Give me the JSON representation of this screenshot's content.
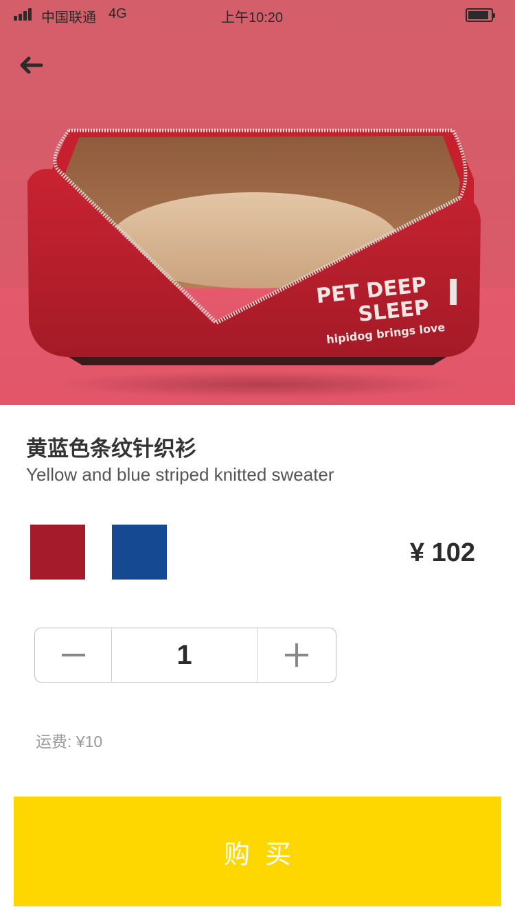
{
  "status_bar": {
    "carrier": "中国联通",
    "network": "4G",
    "time": "上午10:20",
    "battery_level": 0.9
  },
  "header": {
    "back_icon": "arrow-left-icon"
  },
  "product": {
    "image_text_line1": "PET DEEP",
    "image_text_line2": "SLEEP",
    "image_text_line3": "hipidog brings love",
    "title_zh": "黄蓝色条纹针织衫",
    "title_en": "Yellow and blue striped knitted sweater",
    "price": "¥ 102",
    "colors": [
      "#a61b2b",
      "#154a92"
    ]
  },
  "quantity": {
    "value": "1",
    "minus_icon": "minus-icon",
    "plus_icon": "plus-icon"
  },
  "shipping": {
    "text": "运费: ¥10"
  },
  "actions": {
    "buy_label": "购买"
  }
}
